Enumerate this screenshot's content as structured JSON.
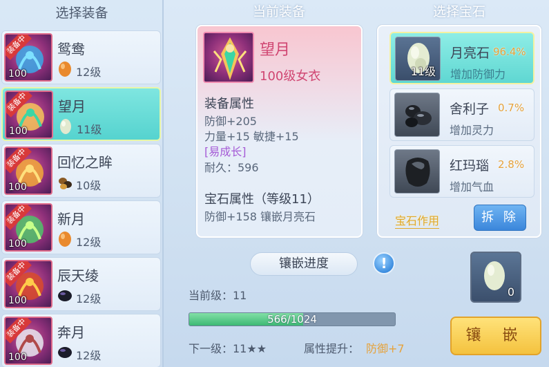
{
  "left": {
    "title": "选择装备",
    "items": [
      {
        "name": "鸳鸯",
        "badge": "装备中",
        "level": "100",
        "gem_level": "12级",
        "gem": "orange"
      },
      {
        "name": "望月",
        "badge": "装备中",
        "level": "100",
        "gem_level": "11级",
        "gem": "pale"
      },
      {
        "name": "回忆之眸",
        "badge": "装备中",
        "level": "100",
        "gem_level": "10级",
        "gem": "dark-multi"
      },
      {
        "name": "新月",
        "badge": "装备中",
        "level": "100",
        "gem_level": "12级",
        "gem": "orange"
      },
      {
        "name": "辰天绫",
        "badge": "装备中",
        "level": "100",
        "gem_level": "12级",
        "gem": "black"
      },
      {
        "name": "奔月",
        "badge": "装备中",
        "level": "100",
        "gem_level": "12级",
        "gem": "black"
      }
    ]
  },
  "current": {
    "title": "当前装备",
    "name": "望月",
    "subtitle": "100级女衣",
    "equip_attr_head": "装备属性",
    "equip_attrs": [
      "防御+205",
      "力量+15 敏捷+15"
    ],
    "growth": "[易成长]",
    "durability": "耐久：596",
    "gem_attr_head": "宝石属性（等级11）",
    "gem_attr": "防御+158 镶嵌月亮石"
  },
  "gems": {
    "title": "选择宝石",
    "items": [
      {
        "name": "月亮石",
        "rate": "96.4%",
        "effect": "增加防御力",
        "level": "11级"
      },
      {
        "name": "舍利子",
        "rate": "0.7%",
        "effect": "增加灵力",
        "level": ""
      },
      {
        "name": "红玛瑙",
        "rate": "2.8%",
        "effect": "增加气血",
        "level": ""
      }
    ],
    "use_link": "宝石作用",
    "remove_label": "拆 除"
  },
  "progress": {
    "title": "镶嵌进度",
    "info_symbol": "!",
    "current_level": "当前级：11",
    "bar_text": "566/1024",
    "fraction": 0.553,
    "next_level": "下一级：11★★",
    "attr_up_label": "属性提升：",
    "attr_up_value": "防御+7",
    "slot_count": "0",
    "inlay_label": "镶 嵌"
  },
  "colors": {
    "selected_row": "#55d3cf",
    "accent_gold": "#e6a23a",
    "name_pink": "#d04672",
    "remove_blue": "#3b86db"
  }
}
